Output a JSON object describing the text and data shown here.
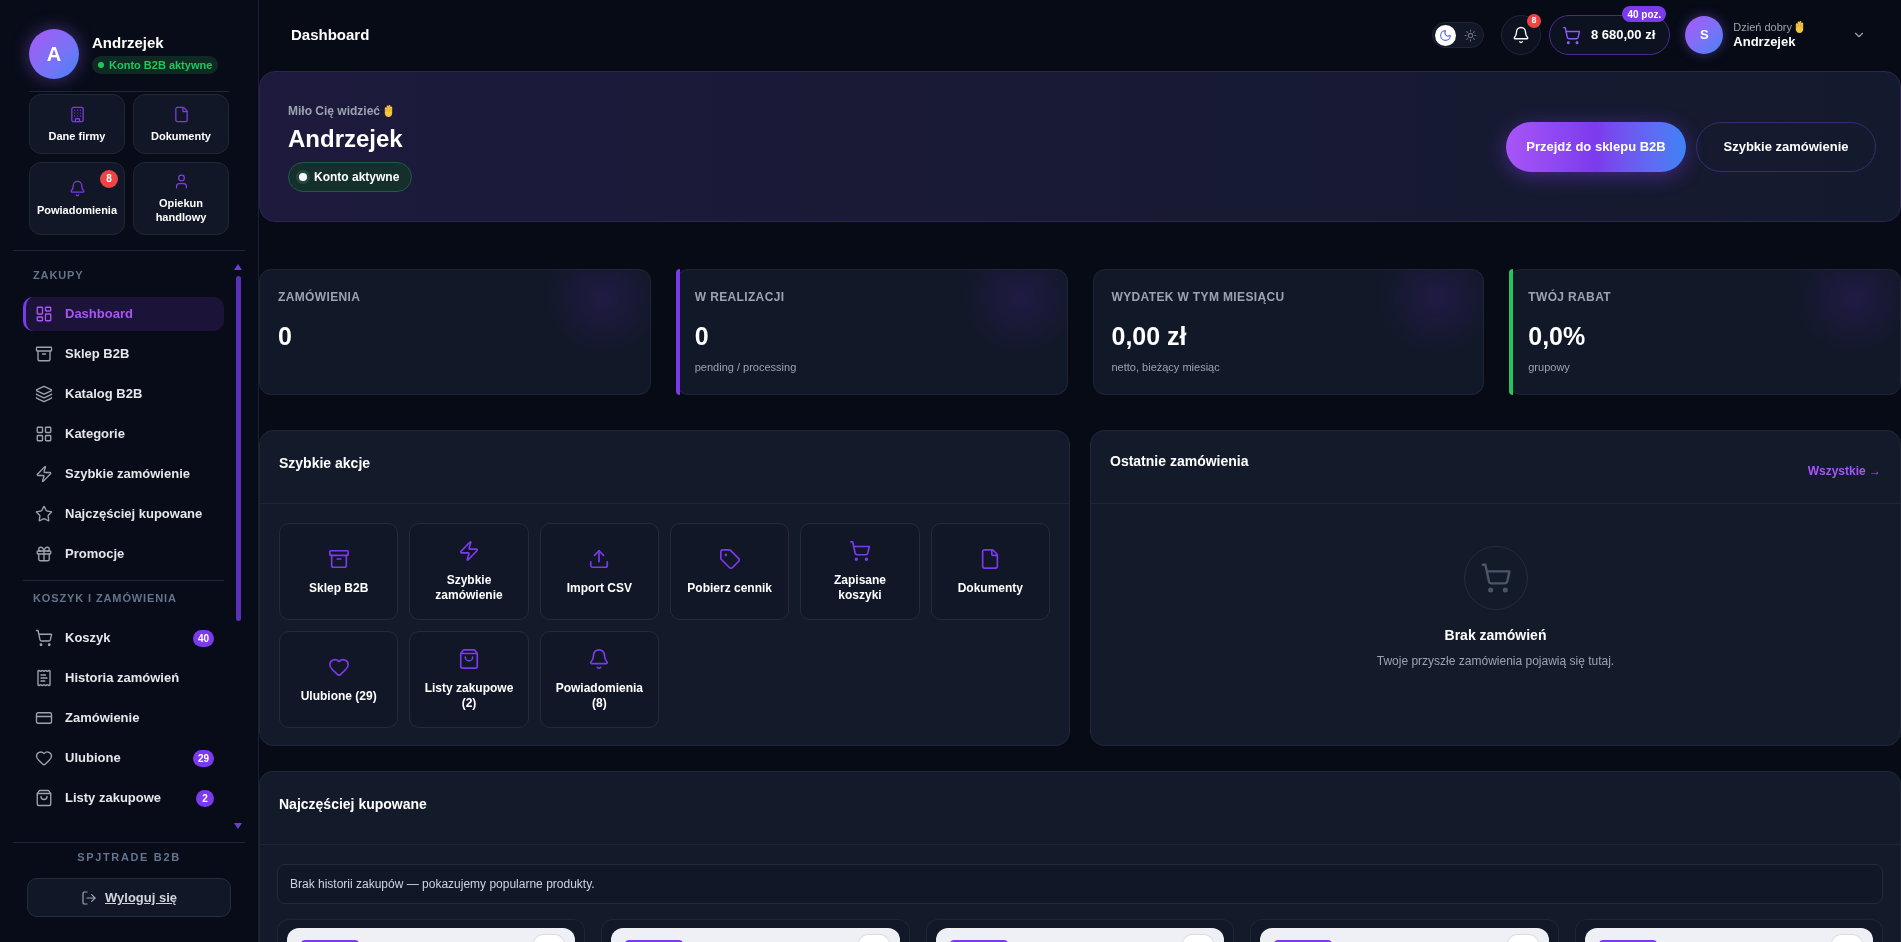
{
  "sidebar": {
    "profile": {
      "initial": "A",
      "name": "Andrzejek",
      "status": "Konto B2B aktywne"
    },
    "shortcuts": [
      {
        "label": "Dane firmy"
      },
      {
        "label": "Dokumenty"
      },
      {
        "label": "Powiadomienia",
        "badge": "8"
      },
      {
        "label": "Opiekun handlowy"
      }
    ],
    "sections": [
      {
        "heading": "ZAKUPY",
        "items": [
          {
            "label": "Dashboard",
            "selected": true
          },
          {
            "label": "Sklep B2B",
            "selected": false
          },
          {
            "label": "Katalog B2B",
            "selected": false
          },
          {
            "label": "Kategorie",
            "selected": false
          },
          {
            "label": "Szybkie zamówienie",
            "selected": false
          },
          {
            "label": "Najczęściej kupowane",
            "selected": false
          },
          {
            "label": "Promocje",
            "selected": false
          }
        ]
      },
      {
        "heading": "KOSZYK I ZAMÓWIENIA",
        "items": [
          {
            "label": "Koszyk",
            "selected": false,
            "count": "40"
          },
          {
            "label": "Historia zamówień",
            "selected": false
          },
          {
            "label": "Zamówienie",
            "selected": false
          },
          {
            "label": "Ulubione",
            "selected": false,
            "count": "29"
          },
          {
            "label": "Listy zakupowe",
            "selected": false,
            "count": "2"
          }
        ]
      }
    ],
    "brand": "SPJTRADE B2B",
    "logout": "Wyloguj się"
  },
  "header": {
    "title": "Dashboard",
    "theme_toggle": [
      {
        "kind": "moon",
        "selected": true
      },
      {
        "kind": "sun",
        "selected": false
      }
    ],
    "notifications_badge": "8",
    "cart": {
      "total": "8 680,00 zł",
      "count": "40 poz."
    },
    "user": {
      "initial": "S",
      "greeting": "Dzień dobry",
      "name": "Andrzejek"
    }
  },
  "hero": {
    "greeting": "Miło Cię widzieć",
    "name": "Andrzejek",
    "status": "Konto aktywne",
    "buttons": [
      {
        "label": "Przejdź do sklepu B2B",
        "kind": "primary"
      },
      {
        "label": "Szybkie zamówienie",
        "kind": "outline"
      }
    ]
  },
  "stats": [
    {
      "label": "ZAMÓWIENIA",
      "value": "0"
    },
    {
      "label": "W REALIZACJI",
      "value": "0",
      "note": "pending / processing",
      "color": "#7c3aed"
    },
    {
      "label": "WYDATEK W TYM MIESIĄCU",
      "value": "0,00 zł",
      "note": "netto, bieżący miesiąc"
    },
    {
      "label": "TWÓJ RABAT",
      "value": "0,0%",
      "note": "grupowy",
      "color": "#22c55e"
    }
  ],
  "quick_actions": {
    "title": "Szybkie akcje",
    "items": [
      "Sklep B2B",
      "Szybkie zamówienie",
      "Import CSV",
      "Pobierz cennik",
      "Zapisane koszyki",
      "Dokumenty",
      "Ulubione (29)",
      "Listy zakupowe (2)",
      "Powiadomienia (8)"
    ]
  },
  "recent_orders": {
    "title": "Ostatnie zamówienia",
    "link": "Wszystkie →",
    "empty_title": "Brak zamówień",
    "empty_text": "Twoje przyszłe zamówienia pojawią się tutaj."
  },
  "top_products": {
    "title": "Najczęściej kupowane",
    "notice": "Brak historii zakupów — pokazujemy popularne produkty.",
    "products": [
      {
        "tag": true
      },
      {
        "tag": true
      },
      {
        "tag": true
      },
      {
        "tag": true
      },
      {
        "tag": true
      }
    ]
  }
}
